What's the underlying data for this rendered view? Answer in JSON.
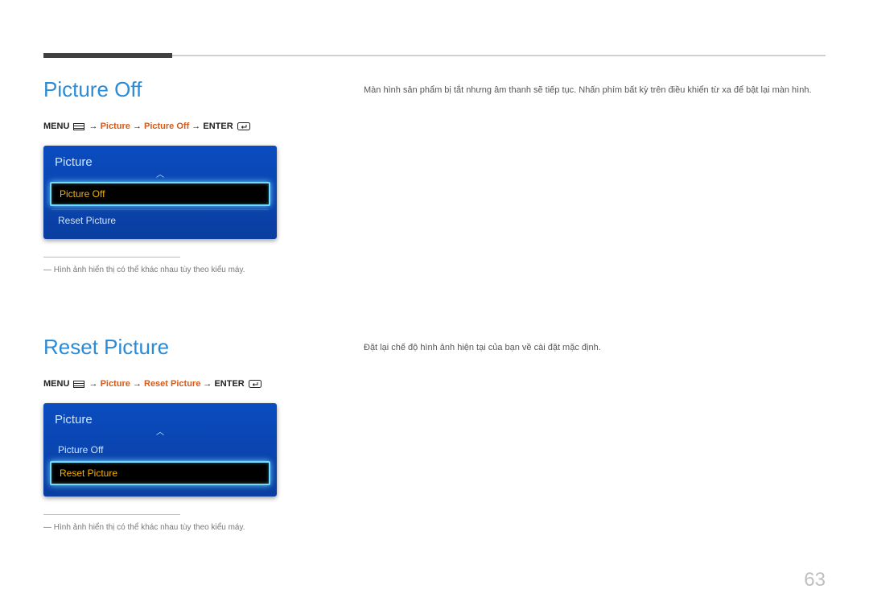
{
  "page_number": "63",
  "section1": {
    "title": "Picture Off",
    "breadcrumb": {
      "menu": "MENU",
      "arrow": "→",
      "step1": "Picture",
      "step2": "Picture Off",
      "enter": "ENTER"
    },
    "menu": {
      "header": "Picture",
      "items": [
        {
          "label": "Picture Off",
          "selected": true
        },
        {
          "label": "Reset Picture",
          "selected": false
        }
      ]
    },
    "footnote": "Hình ảnh hiển thị có thể khác nhau tùy theo kiểu máy.",
    "body": "Màn hình sản phẩm bị tắt nhưng âm thanh sẽ tiếp tục. Nhấn phím bất kỳ trên điều khiển từ xa để bật lại màn hình."
  },
  "section2": {
    "title": "Reset Picture",
    "breadcrumb": {
      "menu": "MENU",
      "arrow": "→",
      "step1": "Picture",
      "step2": "Reset Picture",
      "enter": "ENTER"
    },
    "menu": {
      "header": "Picture",
      "items": [
        {
          "label": "Picture Off",
          "selected": false
        },
        {
          "label": "Reset Picture",
          "selected": true
        }
      ]
    },
    "footnote": "Hình ảnh hiển thị có thể khác nhau tùy theo kiểu máy.",
    "body": "Đặt lại chế độ hình ảnh hiện tại của bạn về cài đặt mặc định."
  }
}
